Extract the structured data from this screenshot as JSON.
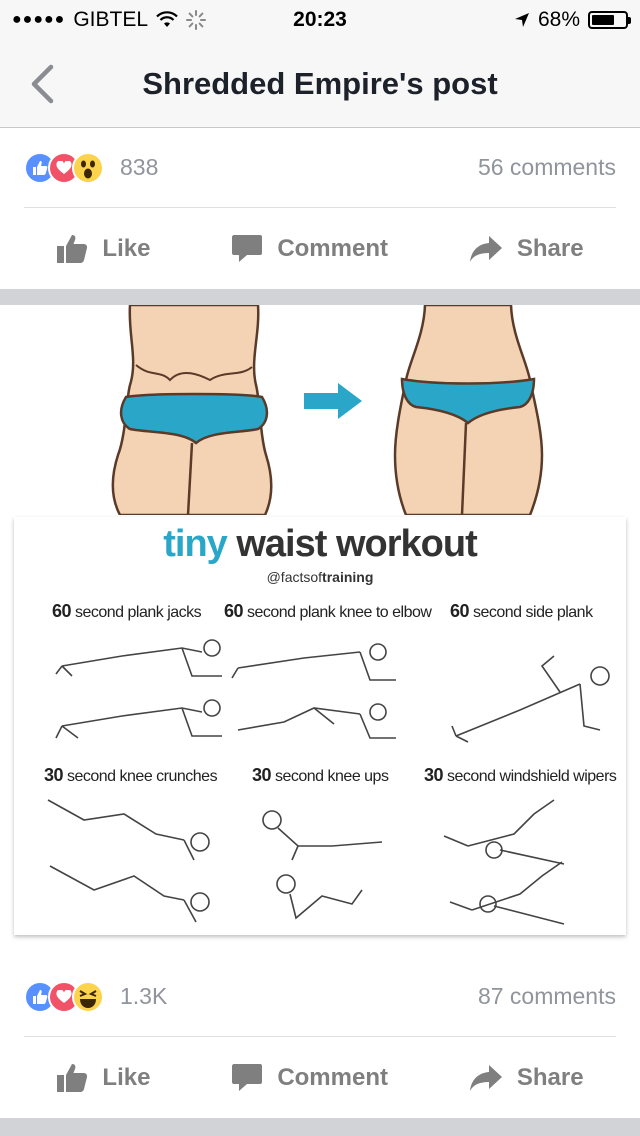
{
  "status_bar": {
    "carrier": "GIBTEL",
    "time": "20:23",
    "battery_percent": "68%",
    "battery_level": 0.68,
    "icons": [
      "signal-dots-icon",
      "wifi-icon",
      "activity-spinner-icon",
      "location-arrow-icon",
      "battery-icon"
    ]
  },
  "nav": {
    "title": "Shredded Empire's post",
    "back_icon": "chevron-left-icon"
  },
  "post1": {
    "reactions": [
      "like",
      "love",
      "wow"
    ],
    "reaction_count": "838",
    "comments": "56 comments"
  },
  "actions": {
    "like": "Like",
    "comment": "Comment",
    "share": "Share"
  },
  "image": {
    "title_tiny": "tiny",
    "title_rest": " waist workout",
    "handle_prefix": "@factsof",
    "handle_bold": "training",
    "exercises": [
      {
        "secs": "60",
        "name": " second plank jacks"
      },
      {
        "secs": "60",
        "name": " second plank knee to elbow"
      },
      {
        "secs": "60",
        "name": " second side plank"
      },
      {
        "secs": "30",
        "name": " second knee crunches"
      },
      {
        "secs": "30",
        "name": " second knee ups"
      },
      {
        "secs": "30",
        "name": " second windshield wipers"
      }
    ],
    "colors": {
      "accent": "#2aa7c8",
      "skin": "#f4d3b4",
      "outline": "#5a3a28"
    }
  },
  "post2": {
    "reactions": [
      "like",
      "love",
      "haha"
    ],
    "reaction_count": "1.3K",
    "comments": "87 comments"
  },
  "colors": {
    "like_blue": "#5890ff",
    "love_red": "#f25268",
    "emoji_yellow": "#fcd34d",
    "meta_gray": "#90949c",
    "action_gray": "#7f7f7f"
  }
}
